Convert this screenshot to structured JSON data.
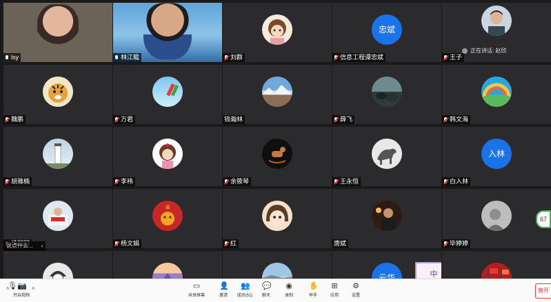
{
  "participants": [
    {
      "name": "lsy",
      "kind": "video",
      "mic": "on"
    },
    {
      "name": "林江龍",
      "kind": "video2",
      "mic": "on"
    },
    {
      "name": "刘群",
      "kind": "avatar",
      "art": "cartoon-girl-1",
      "mic": "muted"
    },
    {
      "name": "信息工程谭忠斌",
      "kind": "text",
      "avatar_text": "忠斌",
      "mic": "muted"
    },
    {
      "name": "王子",
      "kind": "avatar",
      "art": "man-portrait",
      "mic": "muted"
    },
    {
      "name": "魏鹏",
      "kind": "avatar",
      "art": "tiger",
      "mic": "muted"
    },
    {
      "name": "万君",
      "kind": "avatar",
      "art": "sky-pencil",
      "mic": "muted"
    },
    {
      "name": "钱瀚林",
      "kind": "avatar",
      "art": "landscape",
      "mic": "none"
    },
    {
      "name": "薛飞",
      "kind": "avatar",
      "art": "rocks-lake",
      "mic": "muted"
    },
    {
      "name": "韩文海",
      "kind": "avatar",
      "art": "rainbow-hills",
      "mic": "muted"
    },
    {
      "name": "胡雅楠",
      "kind": "avatar",
      "art": "lighthouse",
      "mic": "muted"
    },
    {
      "name": "李袆",
      "kind": "avatar",
      "art": "cartoon-girl-2",
      "mic": "muted"
    },
    {
      "name": "余筱琴",
      "kind": "avatar",
      "art": "rocking-horse",
      "mic": "muted"
    },
    {
      "name": "王永恒",
      "kind": "avatar",
      "art": "horse-sketch",
      "mic": "muted"
    },
    {
      "name": "白入林",
      "kind": "text",
      "avatar_text": "入林",
      "mic": "muted"
    },
    {
      "name": "杨园园",
      "kind": "avatar",
      "art": "room",
      "mic": "muted"
    },
    {
      "name": "杨文娟",
      "kind": "avatar",
      "art": "red-tiger",
      "mic": "muted"
    },
    {
      "name": "红",
      "kind": "avatar",
      "art": "cartoon-face",
      "mic": "muted"
    },
    {
      "name": "唐斌",
      "kind": "avatar",
      "art": "man-night",
      "mic": "none"
    },
    {
      "name": "毕婷婷",
      "kind": "avatar",
      "art": "grey-portrait",
      "mic": "muted"
    },
    {
      "name": "",
      "kind": "avatar",
      "art": "sketch-boy",
      "mic": "none"
    },
    {
      "name": "",
      "kind": "avatar",
      "art": "lavender",
      "mic": "none"
    },
    {
      "name": "",
      "kind": "avatar",
      "art": "coast",
      "mic": "none"
    },
    {
      "name": "",
      "kind": "text",
      "avatar_text": "云华",
      "mic": "none"
    },
    {
      "name": "",
      "kind": "avatar",
      "art": "red-flags",
      "mic": "none"
    }
  ],
  "speaking": {
    "label": "正在讲话: 赵欣"
  },
  "chat_hint": {
    "text": "说点什么..."
  },
  "side_badge": {
    "count": "67"
  },
  "float_badge": {
    "text": "中"
  },
  "toolbar": {
    "video_label": "开启视频",
    "share_label": "共享屏幕",
    "invite_label": "邀请",
    "members_label": "成员(51)",
    "chat_label": "聊天",
    "record_label": "录制",
    "raise_label": "举手",
    "apps_label": "应用",
    "settings_label": "设置",
    "leave_label": "离开"
  },
  "colors": {
    "tile_bg": "#2b2b2d",
    "accent_blue": "#1a73e8",
    "muted_red": "#e53935",
    "toolbar_bg": "#fafafa"
  }
}
